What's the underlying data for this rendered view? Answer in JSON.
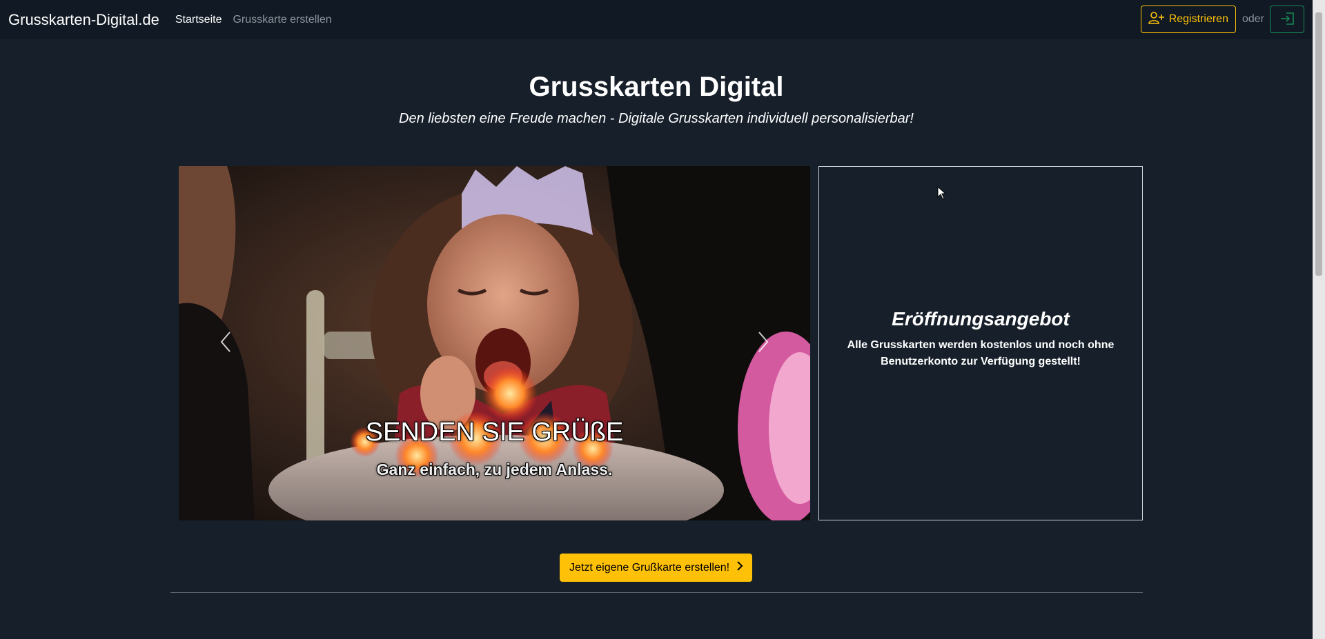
{
  "navbar": {
    "brand": "Grusskarten-Digital.de",
    "links": [
      {
        "label": "Startseite",
        "active": true
      },
      {
        "label": "Grusskarte erstellen",
        "active": false
      }
    ],
    "register_label": "Registrieren",
    "or_label": "oder",
    "login_icon": "box-arrow-in-right-icon"
  },
  "header": {
    "title": "Grusskarten Digital",
    "subtitle": "Den liebsten eine Freude machen - Digitale Grusskarten individuell personalisierbar!"
  },
  "carousel": {
    "slide_caption_title": "SENDEN SIE GRÜßE",
    "slide_caption_subtitle": "Ganz einfach, zu jedem Anlass."
  },
  "offer": {
    "title": "Eröffnungsangebot",
    "text": "Alle Grusskarten werden kostenlos und noch ohne Benutzerkonto zur Verfügung gestellt!"
  },
  "cta": {
    "label": "Jetzt eigene Grußkarte erstellen!"
  },
  "colors": {
    "background": "#161f2a",
    "navbar": "#111a24",
    "accent": "#ffc107",
    "login": "#198754"
  }
}
